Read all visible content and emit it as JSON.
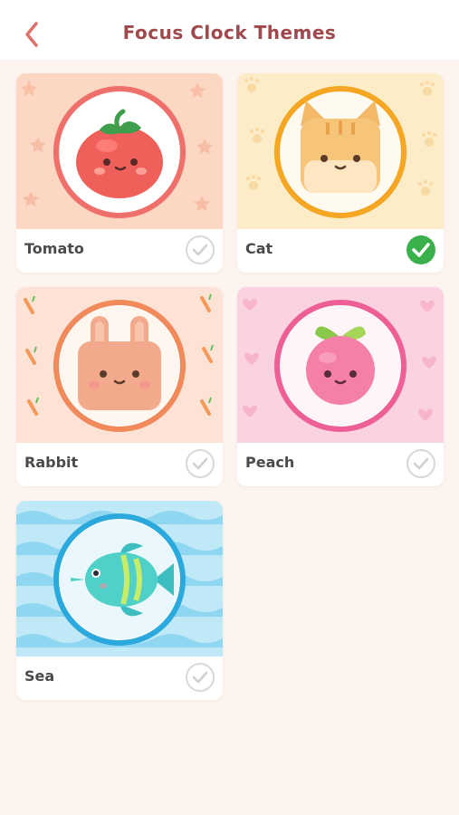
{
  "header": {
    "title": "Focus Clock Themes",
    "back_icon": "chevron-left-icon"
  },
  "themes": [
    {
      "name": "Tomato",
      "selected": false
    },
    {
      "name": "Cat",
      "selected": true
    },
    {
      "name": "Rabbit",
      "selected": false
    },
    {
      "name": "Peach",
      "selected": false
    },
    {
      "name": "Sea",
      "selected": false
    }
  ],
  "colors": {
    "accent": "#a0484c",
    "selected_check": "#3ab04a",
    "unselected_check": "#d8d8d8"
  }
}
